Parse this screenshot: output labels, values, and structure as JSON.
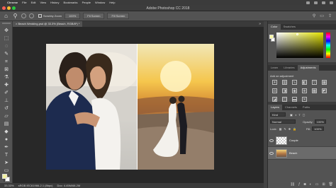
{
  "menubar": {
    "items": [
      "Chrome",
      "File",
      "Edit",
      "View",
      "History",
      "Bookmarks",
      "People",
      "Window",
      "Help"
    ]
  },
  "window": {
    "title": "Adobe Photoshop CC 2018"
  },
  "options_bar": {
    "scrub_zoom_label": "Scrubby Zoom",
    "zoom_percent": "100%",
    "fit_screen": "Fit Screen",
    "fill_screen": "Fill Screen"
  },
  "document": {
    "tab_label": "× Beach Wedding.psd @ 33.3% (Beach, RGB/8*) *",
    "zoom": "33.33%",
    "status": "Doc: 4.45M/68.2M",
    "profile": "sRGB IEC61966-2.1 (8bpc)"
  },
  "color_panel": {
    "tabs": [
      "Color",
      "Swatches"
    ],
    "active": "Color",
    "fg_color": "#f4f4a2",
    "bg_color": "#ffffff"
  },
  "adjustments_panel": {
    "tabs": [
      "Learn",
      "Libraries",
      "Adjustments"
    ],
    "active": "Adjustments",
    "add_label": "Add an adjustment",
    "icons": [
      "brightness-icon",
      "levels-icon",
      "curves-icon",
      "exposure-icon",
      "vibrance-icon",
      "hue-sat-icon",
      "color-balance-icon",
      "bw-icon",
      "photo-filter-icon",
      "channel-mixer-icon",
      "lookup-icon",
      "invert-icon",
      "posterize-icon",
      "threshold-icon",
      "gradient-map-icon",
      "selective-color-icon"
    ]
  },
  "layers_panel": {
    "tabs": [
      "Layers",
      "Channels",
      "Paths"
    ],
    "active": "Layers",
    "filter_label": "Kind",
    "blend_mode": "Normal",
    "opacity_label": "Opacity:",
    "opacity_value": "100%",
    "lock_label": "Lock:",
    "fill_label": "Fill:",
    "fill_value": "100%",
    "layers": [
      {
        "name": "Couple",
        "selected": false
      },
      {
        "name": "Beach",
        "selected": true
      }
    ]
  }
}
